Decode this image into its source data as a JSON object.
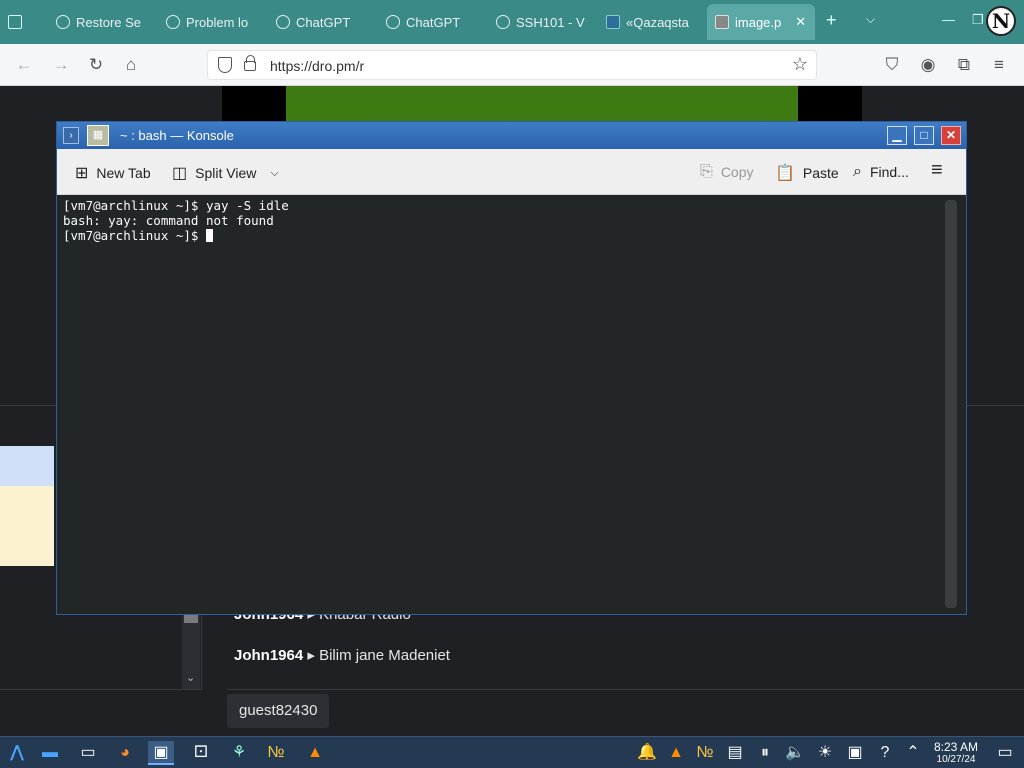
{
  "browser": {
    "tabs": [
      {
        "label": "Restore Se"
      },
      {
        "label": "Problem lo"
      },
      {
        "label": "ChatGPT"
      },
      {
        "label": "ChatGPT"
      },
      {
        "label": "SSH101 - V"
      },
      {
        "label": "«Qazaqsta"
      },
      {
        "label": "image.p"
      }
    ],
    "url": "https://dro.pm/r",
    "profile_letter": "N"
  },
  "konsole": {
    "title": "~ : bash — Konsole",
    "toolbar": {
      "new_tab": "New Tab",
      "split_view": "Split View",
      "copy": "Copy",
      "paste": "Paste",
      "find": "Find..."
    },
    "lines": [
      "[vm7@archlinux ~]$ yay -S idle",
      "bash: yay: command not found",
      "[vm7@archlinux ~]$ "
    ]
  },
  "chat": {
    "messages": [
      {
        "user": "John1964",
        "text": "Khabar Radio"
      },
      {
        "user": "John1964",
        "text": "Bilim jane Madeniet"
      }
    ],
    "guest": "guest82430"
  },
  "taskbar": {
    "time": "8:23 AM",
    "date": "10/27/24"
  }
}
